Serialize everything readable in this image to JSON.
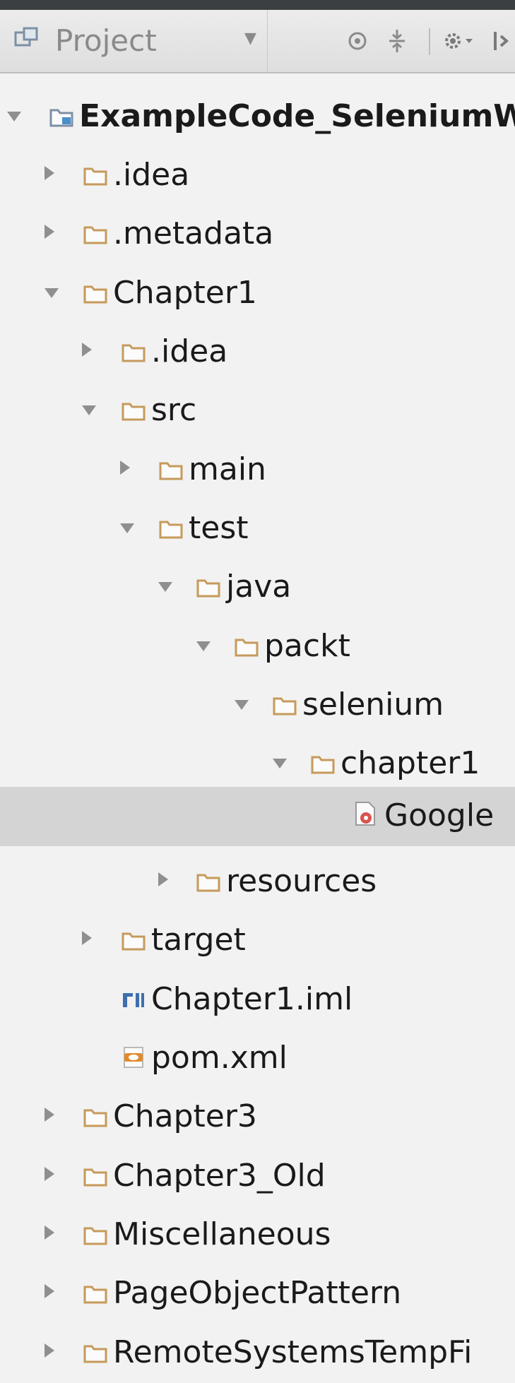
{
  "toolbar": {
    "view_label": "Project",
    "dropdown_icon": "chevron-down-icon",
    "icons": [
      "scroll-from-source-icon",
      "collapse-all-icon",
      "settings-icon",
      "hide-icon"
    ]
  },
  "colors": {
    "folder": "#c69a5b",
    "selection": "#d4d4d4",
    "arrow": "#8f8f8f"
  },
  "tree": {
    "items": [
      {
        "label": "ExampleCode_SeleniumW",
        "type": "module",
        "expanded": true,
        "bold": true
      },
      {
        "label": ".idea",
        "type": "folder",
        "expanded": false
      },
      {
        "label": ".metadata",
        "type": "folder",
        "expanded": false
      },
      {
        "label": "Chapter1",
        "type": "folder",
        "expanded": true
      },
      {
        "label": ".idea",
        "type": "folder",
        "expanded": false
      },
      {
        "label": "src",
        "type": "folder",
        "expanded": true
      },
      {
        "label": "main",
        "type": "folder",
        "expanded": false
      },
      {
        "label": "test",
        "type": "folder",
        "expanded": true
      },
      {
        "label": "java",
        "type": "folder",
        "expanded": true
      },
      {
        "label": "packt",
        "type": "folder",
        "expanded": true
      },
      {
        "label": "selenium",
        "type": "folder",
        "expanded": true
      },
      {
        "label": "chapter1",
        "type": "folder",
        "expanded": true
      },
      {
        "label": "Google",
        "type": "java-file",
        "selected": true
      },
      {
        "label": "resources",
        "type": "folder",
        "expanded": false
      },
      {
        "label": "target",
        "type": "folder",
        "expanded": false
      },
      {
        "label": "Chapter1.iml",
        "type": "iml-file"
      },
      {
        "label": "pom.xml",
        "type": "maven-file"
      },
      {
        "label": "Chapter3",
        "type": "folder",
        "expanded": false
      },
      {
        "label": "Chapter3_Old",
        "type": "folder",
        "expanded": false
      },
      {
        "label": "Miscellaneous",
        "type": "folder",
        "expanded": false
      },
      {
        "label": "PageObjectPattern",
        "type": "folder",
        "expanded": false
      },
      {
        "label": "RemoteSystemsTempFi",
        "type": "folder",
        "expanded": false
      }
    ]
  }
}
